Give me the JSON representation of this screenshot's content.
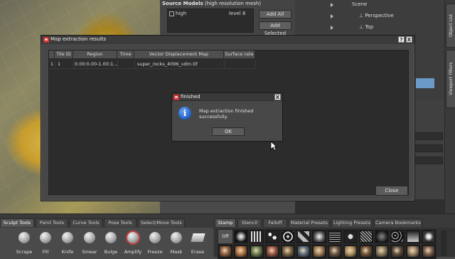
{
  "source_models": {
    "title_bold": "Source Models",
    "title_rest": "(high resolution mesh)",
    "rows": [
      {
        "name": "high",
        "level": "level 8"
      }
    ],
    "add_all_label": "Add All",
    "add_selected_label": "Add Selected"
  },
  "scene_tree": {
    "items": [
      "Scene",
      "Perspective",
      "Top"
    ]
  },
  "right_tabs": [
    "Object List",
    "Viewport Filters"
  ],
  "map_dialog": {
    "title": "Map extraction results",
    "help_label": "?",
    "close_x_label": "X",
    "columns": [
      "Tile ID",
      "Region",
      "Time",
      "Vector Displacement Map",
      "Surface rate"
    ],
    "rows": [
      {
        "index": "1",
        "tile_id": "1",
        "region": "0.00:0.00-1.00:1...",
        "time": "",
        "map": "super_rocks_4096_vdm.tif",
        "surface_rate": ""
      }
    ],
    "close_label": "Close"
  },
  "msg_box": {
    "title": "finished",
    "close_x_label": "X",
    "info_icon_glyph": "i",
    "message": "Map extraction finished successfully.",
    "ok_label": "OK"
  },
  "tool_tabs": [
    "Sculpt Tools",
    "Paint Tools",
    "Curve Tools",
    "Pose Tools",
    "Select/Move Tools"
  ],
  "tools": [
    {
      "label": "Scrape",
      "icon": "scrape-icon"
    },
    {
      "label": "Fill",
      "icon": "fill-icon"
    },
    {
      "label": "Knife",
      "icon": "knife-icon"
    },
    {
      "label": "Smear",
      "icon": "smear-icon"
    },
    {
      "label": "Bulge",
      "icon": "bulge-icon"
    },
    {
      "label": "Amplify",
      "icon": "amplify-icon"
    },
    {
      "label": "Freeze",
      "icon": "freeze-icon"
    },
    {
      "label": "Mask",
      "icon": "mask-icon"
    },
    {
      "label": "Erase",
      "icon": "erase-icon"
    }
  ],
  "stamp_tabs": [
    "Stamp",
    "Stencil",
    "Falloff",
    "Material Presets",
    "Lighting Presets",
    "Camera Bookmarks"
  ],
  "stamp_off_label": "Off",
  "colors": {
    "accent_selection": "#6c9ac8",
    "titlebar_icon": "#cc3333",
    "info_icon": "#1c5fc9"
  }
}
